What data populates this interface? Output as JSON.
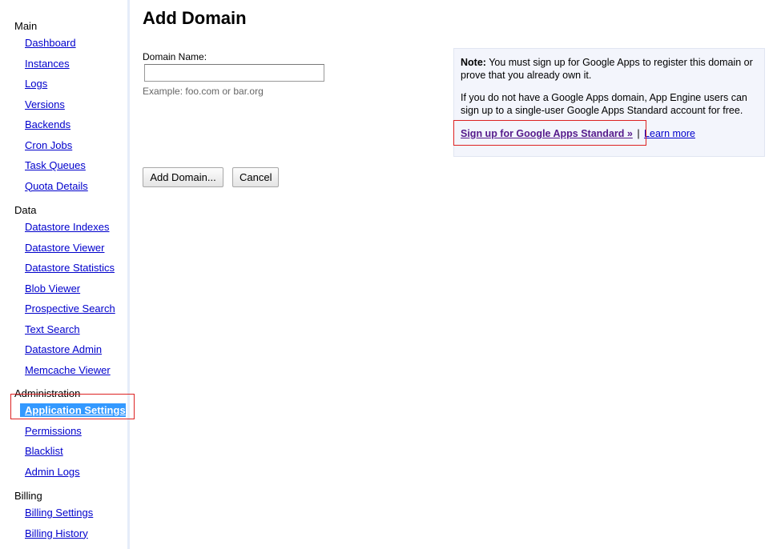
{
  "sidebar": {
    "groups": [
      {
        "heading": "Main",
        "items": [
          "Dashboard",
          "Instances",
          "Logs",
          "Versions",
          "Backends",
          "Cron Jobs",
          "Task Queues",
          "Quota Details"
        ]
      },
      {
        "heading": "Data",
        "items": [
          "Datastore Indexes",
          "Datastore Viewer",
          "Datastore Statistics",
          "Blob Viewer",
          "Prospective Search",
          "Text Search",
          "Datastore Admin",
          "Memcache Viewer"
        ]
      },
      {
        "heading": "Administration",
        "items": [
          "Application Settings",
          "Permissions",
          "Blacklist",
          "Admin Logs"
        ],
        "selected": "Application Settings"
      },
      {
        "heading": "Billing",
        "items": [
          "Billing Settings",
          "Billing History"
        ]
      }
    ]
  },
  "main": {
    "title": "Add Domain",
    "form": {
      "label": "Domain Name:",
      "value": "",
      "placeholder": "",
      "example": "Example: foo.com or bar.org",
      "submit_label": "Add Domain...",
      "cancel_label": "Cancel"
    },
    "note": {
      "lead": "Note:",
      "text": " You must sign up for Google Apps to register this domain or prove that you already own it.",
      "paragraph2": "If you do not have a Google Apps domain, App Engine users can sign up to a single-user Google Apps Standard account for free.",
      "signup_link": "Sign up for Google Apps Standard »",
      "separator": "|",
      "learn_more": "Learn more"
    }
  },
  "colors": {
    "link": "#0000cc",
    "visited_link": "#551a8b",
    "selected_bg": "#3399ff",
    "note_bg": "#f3f5fc",
    "highlight_box": "#dd2222"
  }
}
